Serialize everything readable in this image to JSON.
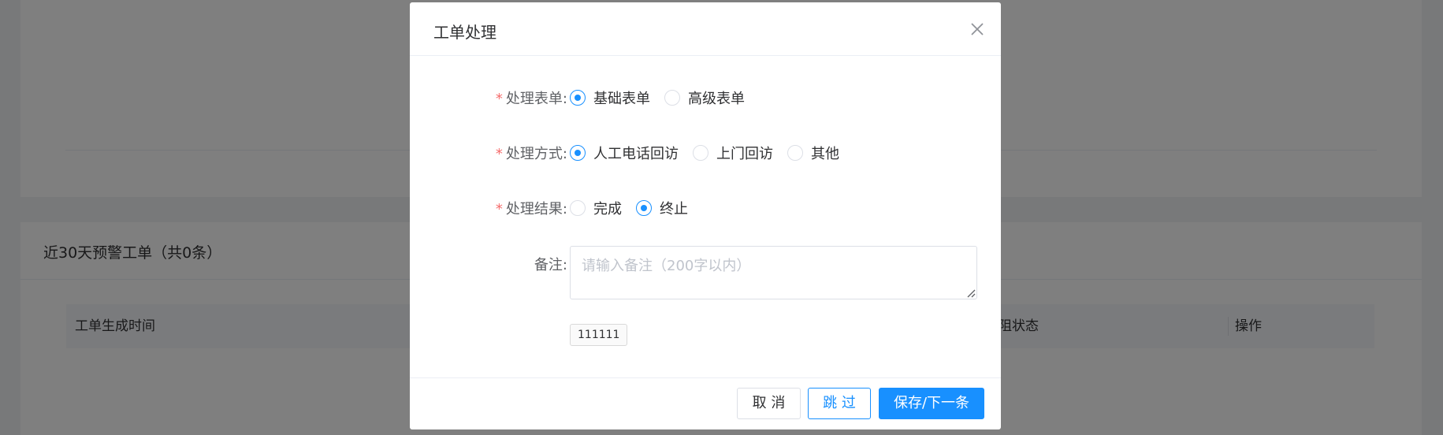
{
  "background": {
    "section_title": "近30天预警工单（共0条）",
    "table_columns": [
      "工单生成时间",
      "阻状态",
      "操作"
    ]
  },
  "dialog": {
    "title": "工单处理",
    "close_icon": "close-icon",
    "form": {
      "form_type": {
        "label": "处理表单:",
        "required": "*",
        "options": [
          "基础表单",
          "高级表单"
        ],
        "selected": "基础表单"
      },
      "method": {
        "label": "处理方式:",
        "required": "*",
        "options": [
          "人工电话回访",
          "上门回访",
          "其他"
        ],
        "selected": "人工电话回访"
      },
      "result": {
        "label": "处理结果:",
        "required": "*",
        "options": [
          "完成",
          "终止"
        ],
        "selected": "终止"
      },
      "remark": {
        "label": "备注:",
        "value": "",
        "placeholder": "请输入备注（200字以内）"
      },
      "tag": "111111"
    },
    "footer": {
      "cancel_label": "取 消",
      "skip_label": "跳 过",
      "save_label": "保存/下一条"
    }
  },
  "colors": {
    "primary": "#1890ff",
    "required": "#f56c6c"
  }
}
